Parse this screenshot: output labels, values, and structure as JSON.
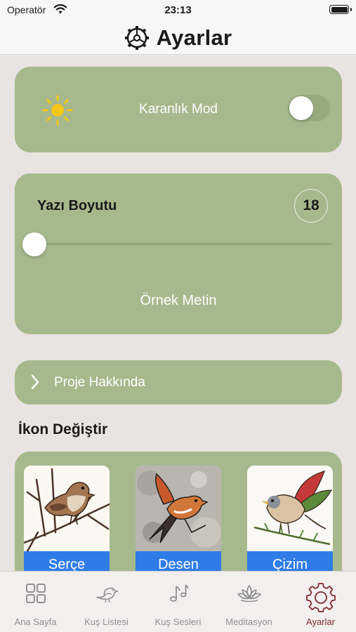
{
  "status": {
    "carrier": "Operatör",
    "time": "23:13"
  },
  "header": {
    "title": "Ayarlar",
    "icon": "gear-icon"
  },
  "dark_mode": {
    "label": "Karanlık Mod",
    "enabled": false,
    "icon": "sun-icon"
  },
  "font_size": {
    "title": "Yazı Boyutu",
    "value": "18",
    "slider_fraction": 0,
    "sample": "Örnek Metin"
  },
  "about": {
    "label": "Proje Hakkında"
  },
  "icon_section": {
    "title": "İkon Değiştir",
    "options": [
      {
        "label": "Serçe"
      },
      {
        "label": "Desen"
      },
      {
        "label": "Çizim"
      }
    ]
  },
  "tabs": [
    {
      "label": "Ana Sayfa",
      "icon": "grid-icon",
      "active": false
    },
    {
      "label": "Kuş Listesi",
      "icon": "bird-icon",
      "active": false
    },
    {
      "label": "Kuş Sesleri",
      "icon": "music-note-icon",
      "active": false
    },
    {
      "label": "Meditasyon",
      "icon": "lotus-icon",
      "active": false
    },
    {
      "label": "Ayarlar",
      "icon": "gear-icon",
      "active": true
    }
  ],
  "colors": {
    "card": "#a6b98c",
    "accent": "#7e2a2a",
    "caption": "#2f7ce6",
    "background": "#e8e4e2"
  }
}
